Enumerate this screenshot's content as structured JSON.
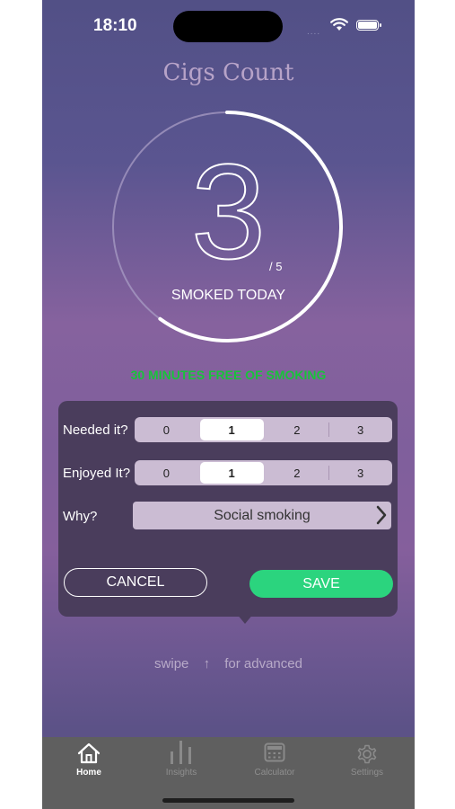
{
  "status_bar": {
    "time": "18:10",
    "signal": "....",
    "wifi_icon": "wifi-icon",
    "battery_icon": "battery-icon"
  },
  "app": {
    "title": "Cigs Count"
  },
  "counter": {
    "smoked": "3",
    "goal": "/ 5",
    "label": "SMOKED TODAY",
    "progress_fraction": 0.6
  },
  "free_message": "30 MINUTES FREE OF SMOKING",
  "form": {
    "needed": {
      "label": "Needed it?",
      "options": [
        "0",
        "1",
        "2",
        "3"
      ],
      "selected": "1"
    },
    "enjoyed": {
      "label": "Enjoyed It?",
      "options": [
        "0",
        "1",
        "2",
        "3"
      ],
      "selected": "1"
    },
    "why": {
      "label": "Why?",
      "value": "Social smoking"
    },
    "cancel_label": "CANCEL",
    "save_label": "SAVE"
  },
  "swipe_hint": {
    "prefix": "swipe",
    "arrow": "↑",
    "suffix": "for advanced"
  },
  "tabs": [
    {
      "label": "Home",
      "icon": "house-icon",
      "active": true
    },
    {
      "label": "Insights",
      "icon": "bar-chart-icon",
      "active": false
    },
    {
      "label": "Calculator",
      "icon": "calculator-icon",
      "active": false
    },
    {
      "label": "Settings",
      "icon": "gear-icon",
      "active": false
    }
  ],
  "colors": {
    "accent_green": "#2bd47e",
    "free_text": "#18c43a",
    "panel": "#4a3d5c",
    "segment": "#cbbcd3"
  }
}
